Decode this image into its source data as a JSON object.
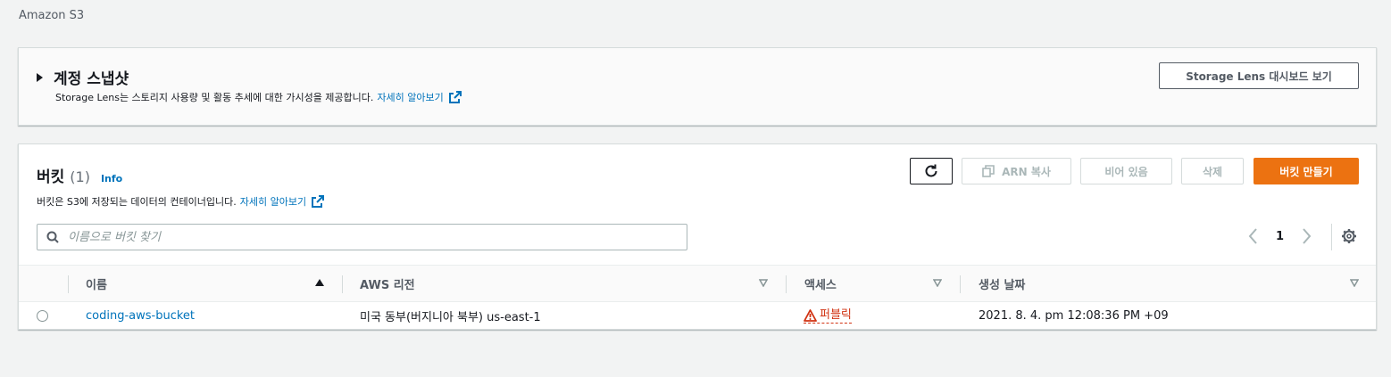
{
  "breadcrumb": "Amazon S3",
  "snapshot": {
    "title": "계정 스냅샷",
    "description": "Storage Lens는 스토리지 사용량 및 활동 추세에 대한 가시성을 제공합니다.",
    "learn_more": "자세히 알아보기",
    "dashboard_button": "Storage Lens 대시보드 보기"
  },
  "buckets": {
    "title": "버킷",
    "count": "(1)",
    "info": "Info",
    "description": "버킷은 S3에 저장되는 데이터의 컨테이너입니다.",
    "learn_more": "자세히 알아보기",
    "toolbar": {
      "copy_arn": "ARN 복사",
      "empty": "비어 있음",
      "delete": "삭제",
      "create": "버킷 만들기"
    },
    "search_placeholder": "이름으로 버킷 찾기",
    "page": "1",
    "columns": {
      "name": "이름",
      "region": "AWS 리전",
      "access": "액세스",
      "created": "생성 날짜"
    },
    "rows": [
      {
        "name": "coding-aws-bucket",
        "region": "미국 동부(버지니아 북부) us-east-1",
        "access": "퍼블릭",
        "created": "2021. 8. 4. pm 12:08:36 PM +09"
      }
    ]
  },
  "colors": {
    "primary": "#ec7211",
    "link": "#0073bb",
    "warning": "#d13212"
  }
}
